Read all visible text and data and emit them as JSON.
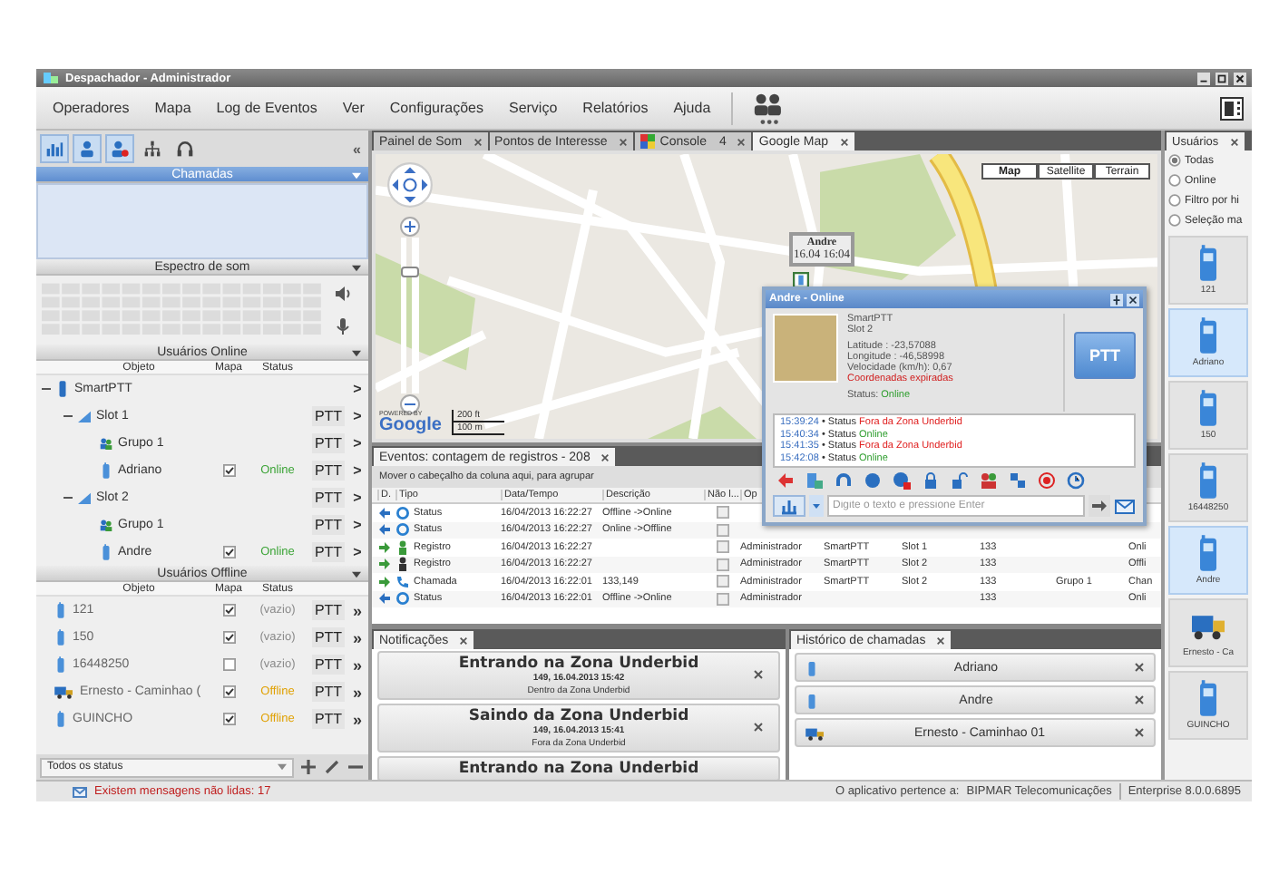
{
  "window": {
    "title": "Despachador - Administrador"
  },
  "menu": [
    "Operadores",
    "Mapa",
    "Log de Eventos",
    "Ver",
    "Configurações",
    "Serviço",
    "Relatórios",
    "Ajuda"
  ],
  "left_panel": {
    "tools": [
      {
        "selected": true
      },
      {
        "selected": true
      },
      {
        "selected": true
      },
      {
        "selected": false
      },
      {
        "selected": false
      }
    ],
    "collapse": "«",
    "calls_header": "Chamadas",
    "spectrum_header": "Espectro de som",
    "online": {
      "header": "Usuários Online",
      "columns": [
        "Objeto",
        "Mapa",
        "Status"
      ],
      "tree": [
        {
          "name": "SmartPTT",
          "kind": "device",
          "expanded": true,
          "more": ">",
          "children": [
            {
              "name": "Slot 1",
              "kind": "slot",
              "expanded": true,
              "ptt": "PTT",
              "more": ">",
              "children": [
                {
                  "name": "Grupo 1",
                  "kind": "group",
                  "ptt": "PTT",
                  "more": ">"
                },
                {
                  "name": "Adriano",
                  "kind": "radio",
                  "map_checked": true,
                  "status": "Online",
                  "color": "#3aa335",
                  "ptt": "PTT",
                  "more": ">"
                }
              ]
            },
            {
              "name": "Slot 2",
              "kind": "slot",
              "expanded": true,
              "ptt": "PTT",
              "more": ">",
              "children": [
                {
                  "name": "Grupo 1",
                  "kind": "group",
                  "ptt": "PTT",
                  "more": ">"
                },
                {
                  "name": "Andre",
                  "kind": "radio",
                  "map_checked": true,
                  "status": "Online",
                  "color": "#3aa335",
                  "ptt": "PTT",
                  "more": ">"
                }
              ]
            }
          ]
        }
      ]
    },
    "offline": {
      "header": "Usuários Offline",
      "columns": [
        "Objeto",
        "Mapa",
        "Status"
      ],
      "rows": [
        {
          "name": "121",
          "kind": "radio",
          "map_checked": true,
          "status": "(vazio)",
          "color": "#8a8a8a",
          "ptt": "PTT",
          "more": "»"
        },
        {
          "name": "150",
          "kind": "radio",
          "map_checked": true,
          "status": "(vazio)",
          "color": "#8a8a8a",
          "ptt": "PTT",
          "more": "»"
        },
        {
          "name": "16448250",
          "kind": "radio",
          "map_checked": false,
          "status": "(vazio)",
          "color": "#8a8a8a",
          "ptt": "PTT",
          "more": "»"
        },
        {
          "name": "Ernesto - Caminhao (",
          "kind": "vehicle",
          "map_checked": true,
          "status": "Offline",
          "color": "#e0a000",
          "ptt": "PTT",
          "more": "»"
        },
        {
          "name": "GUINCHO",
          "kind": "radio",
          "map_checked": true,
          "status": "Offline",
          "color": "#e0a000",
          "ptt": "PTT",
          "more": "»"
        }
      ]
    },
    "filter": {
      "value": "Todos os status"
    }
  },
  "tabs": [
    {
      "label": "Painel de Som",
      "selected": false
    },
    {
      "label": "Pontos de Interesse",
      "selected": false
    },
    {
      "label": "Console",
      "count": "4",
      "selected": false
    },
    {
      "label": "Google Map",
      "selected": true
    }
  ],
  "map": {
    "map_types": [
      {
        "label": "Map",
        "selected": true
      },
      {
        "label": "Satellite",
        "selected": false
      },
      {
        "label": "Terrain",
        "selected": false
      }
    ],
    "zoom": {
      "level": 0.8
    },
    "powered": "POWERED BY",
    "logo": "Google",
    "scale": [
      "200 ft",
      "100 m"
    ],
    "marker": {
      "name": "Andre",
      "time": "16.04 16:04"
    }
  },
  "popup": {
    "title": "Andre - Online",
    "lines": [
      "SmartPTT",
      "Slot 2",
      "Latitude : -23,57088",
      "Longitude : -46,58998",
      "Velocidade (km/h): 0,67"
    ],
    "warning": "Coordenadas expiradas",
    "status_label": "Status:",
    "status": "Online",
    "ptt": "PTT",
    "log": [
      {
        "time": "15:39:24",
        "event": "• Status",
        "text": "Fora da Zona Underbid",
        "kind": "alert"
      },
      {
        "time": "15:40:34",
        "event": "• Status",
        "text": "Online",
        "kind": "ok"
      },
      {
        "time": "15:41:35",
        "event": "• Status",
        "text": "Fora da Zona Underbid",
        "kind": "alert"
      },
      {
        "time": "15:42:08",
        "event": "• Status",
        "text": "Online",
        "kind": "ok"
      }
    ],
    "message": {
      "placeholder": "Digite o texto e pressione Enter"
    }
  },
  "events": {
    "tab": "Eventos: contagem de registros - 208",
    "group_hint": "Mover o cabeçalho da coluna aqui, para agrupar",
    "columns": [
      "D.",
      "Tipo",
      "Data/Tempo",
      "Descrição",
      "Não l...",
      "Op"
    ],
    "rows": [
      {
        "incoming": true,
        "kind": "status",
        "type": "Status",
        "datetime": "16/04/2013 16:22:27",
        "description": "Offline ->Online",
        "unread": false
      },
      {
        "incoming": true,
        "kind": "status",
        "type": "Status",
        "datetime": "16/04/2013 16:22:27",
        "description": "Online ->Offline",
        "unread": false
      },
      {
        "incoming": false,
        "kind": "register_on",
        "type": "Registro",
        "datetime": "16/04/2013 16:22:27",
        "unread": false,
        "operator": "Administrador",
        "object": "SmartPTT",
        "slot": "Slot 1",
        "id": "133",
        "status": "Onli"
      },
      {
        "incoming": false,
        "kind": "register_off",
        "type": "Registro",
        "datetime": "16/04/2013 16:22:27",
        "unread": false,
        "operator": "Administrador",
        "object": "SmartPTT",
        "slot": "Slot 2",
        "id": "133",
        "status": "Offli"
      },
      {
        "incoming": false,
        "kind": "call",
        "type": "Chamada",
        "datetime": "16/04/2013 16:22:01",
        "description": "133,149",
        "unread": false,
        "operator": "Administrador",
        "object": "SmartPTT",
        "slot": "Slot 2",
        "id": "133",
        "group": "Grupo 1",
        "status": "Chan"
      },
      {
        "incoming": true,
        "kind": "status",
        "type": "Status",
        "datetime": "16/04/2013 16:22:01",
        "description": "Offline ->Online",
        "unread": false,
        "operator": "Administrador",
        "id": "133",
        "status": "Onli"
      }
    ]
  },
  "notifications": {
    "tab": "Notificações",
    "items": [
      {
        "title": "Entrando na Zona Underbid",
        "meta": "149, 16.04.2013 15:42",
        "detail": "Dentro da Zona Underbid"
      },
      {
        "title": "Saindo da Zona Underbid",
        "meta": "149, 16.04.2013 15:41",
        "detail": "Fora da Zona Underbid"
      },
      {
        "title": "Entrando na Zona Underbid"
      }
    ]
  },
  "call_history": {
    "tab": "Histórico de chamadas",
    "items": [
      {
        "name": "Adriano",
        "kind": "radio"
      },
      {
        "name": "Andre",
        "kind": "radio"
      },
      {
        "name": "Ernesto - Caminhao 01",
        "kind": "vehicle"
      }
    ]
  },
  "users_panel": {
    "tab": "Usuários",
    "filters": [
      {
        "label": "Todas",
        "selected": true
      },
      {
        "label": "Online",
        "selected": false
      },
      {
        "label": "Filtro por hi",
        "selected": false
      },
      {
        "label": "Seleção ma",
        "selected": false
      }
    ],
    "tiles": [
      {
        "name": "121",
        "kind": "radio",
        "selected": false
      },
      {
        "name": "Adriano",
        "kind": "radio",
        "selected": true
      },
      {
        "name": "150",
        "kind": "radio",
        "selected": false
      },
      {
        "name": "16448250",
        "kind": "radio",
        "selected": false
      },
      {
        "name": "Andre",
        "kind": "radio",
        "selected": true
      },
      {
        "name": "Ernesto - Ca",
        "kind": "vehicle",
        "selected": false
      },
      {
        "name": "GUINCHO",
        "kind": "radio",
        "selected": false
      }
    ]
  },
  "status_bar": {
    "message": "Existem mensagens não lidas: 17",
    "owner_label": "O aplicativo pertence a:",
    "owner": "BIPMAR Telecomunicações",
    "version": "Enterprise 8.0.0.6895"
  }
}
